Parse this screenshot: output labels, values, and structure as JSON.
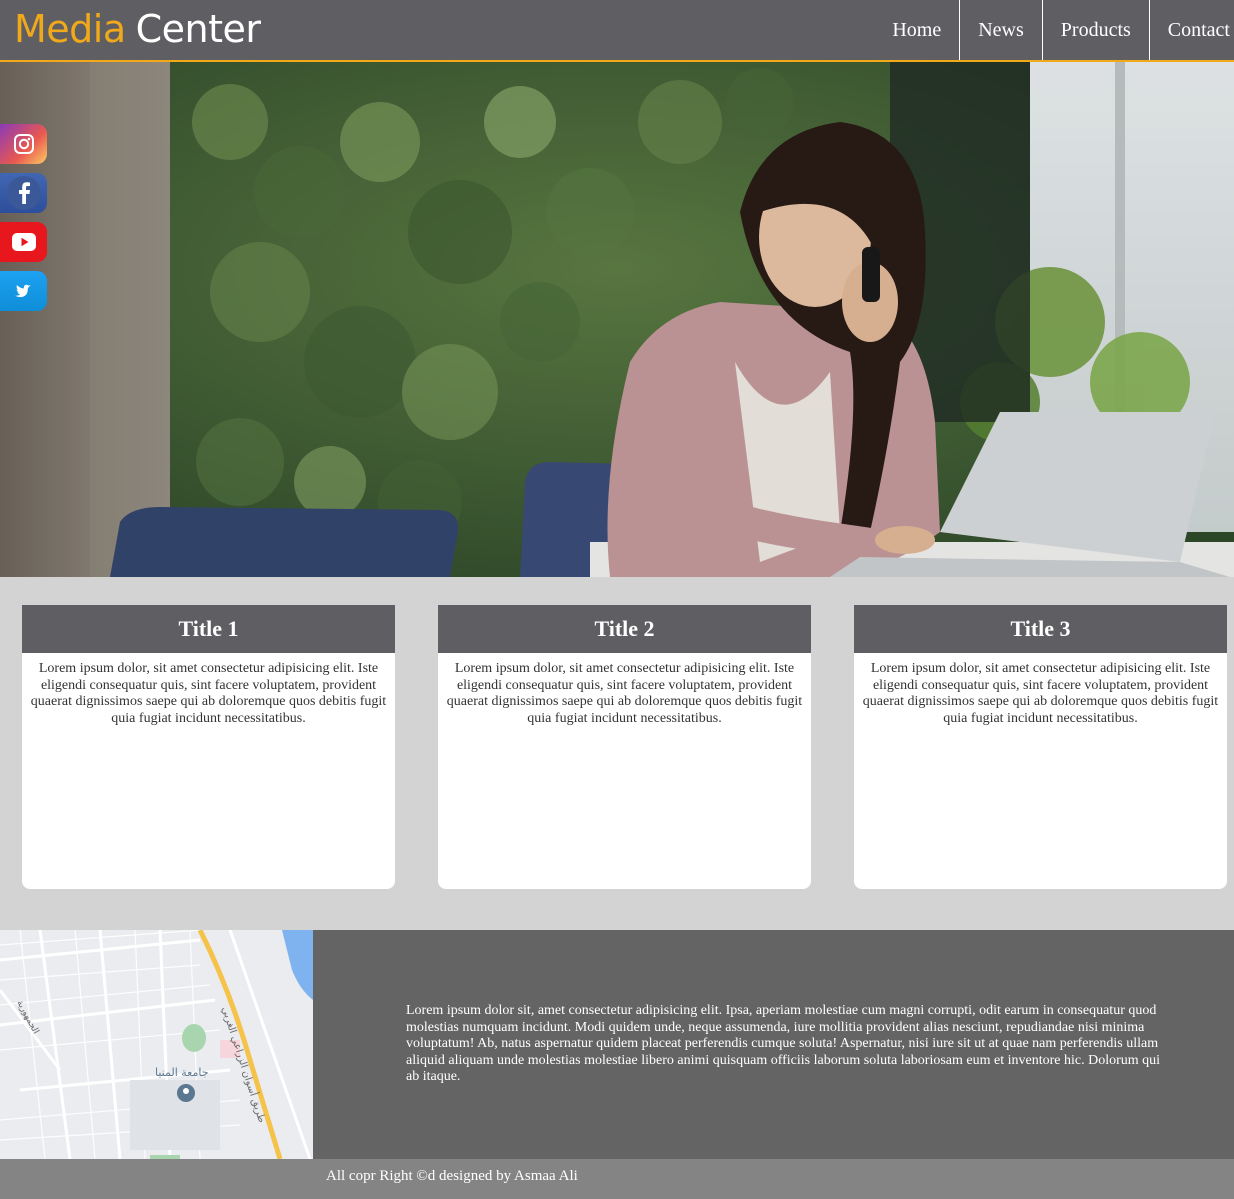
{
  "header": {
    "logo_part1": "Media",
    "logo_part2": "Center",
    "nav": [
      "Home",
      "News",
      "Products",
      "Contact"
    ]
  },
  "social": [
    {
      "icon": "instagram-icon",
      "color": "#c13584"
    },
    {
      "icon": "facebook-icon",
      "color": "#3b5998"
    },
    {
      "icon": "youtube-icon",
      "color": "#e8161d"
    },
    {
      "icon": "twitter-icon",
      "color": "#1da1f2"
    }
  ],
  "cards": [
    {
      "title": "Title 1",
      "text": "Lorem ipsum dolor, sit amet consectetur adipisicing elit. Iste eligendi consequatur quis, sint facere voluptatem, provident quaerat dignissimos saepe qui ab doloremque quos debitis fugit quia fugiat incidunt necessitatibus."
    },
    {
      "title": "Title 2",
      "text": "Lorem ipsum dolor, sit amet consectetur adipisicing elit. Iste eligendi consequatur quis, sint facere voluptatem, provident quaerat dignissimos saepe qui ab doloremque quos debitis fugit quia fugiat incidunt necessitatibus."
    },
    {
      "title": "Title 3",
      "text": "Lorem ipsum dolor, sit amet consectetur adipisicing elit. Iste eligendi consequatur quis, sint facere voluptatem, provident quaerat dignissimos saepe qui ab doloremque quos debitis fugit quia fugiat incidunt necessitatibus."
    }
  ],
  "footer": {
    "text": "Lorem ipsum dolor sit, amet consectetur adipisicing elit. Ipsa, aperiam molestiae cum magni corrupti, odit earum in consequatur quod molestias numquam incidunt. Modi quidem unde, neque assumenda, iure mollitia provident alias nesciunt, repudiandae nisi minima voluptatum! Ab, natus aspernatur quidem placeat perferendis cumque soluta! Aspernatur, nisi iure sit ut at quae nam perferendis ullam aliquid aliquam unde molestias molestiae libero animi quisquam officiis laborum soluta laboriosam eum et inventore hic. Dolorum qui ab itaque.",
    "map_labels": {
      "university": "جامعة المنيا",
      "road": "طريق أسوان الزراعي الغربي",
      "street": "الجمهورية"
    },
    "copyright": "All copr Right ©d designed by Asmaa Ali"
  },
  "colors": {
    "accent": "#f0a91b",
    "header_bg": "#5f5e63",
    "page_bg": "#d3d3d3",
    "footer_bg": "#646464",
    "copyright_bg": "#848484"
  }
}
